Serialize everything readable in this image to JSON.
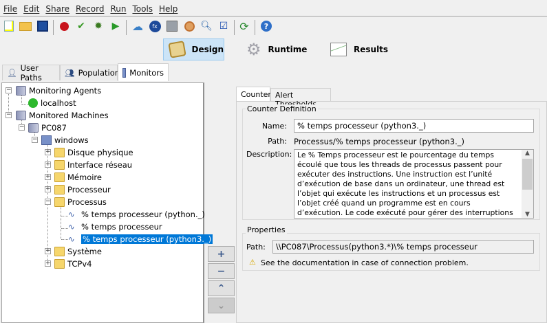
{
  "menu": [
    "File",
    "Edit",
    "Share",
    "Record",
    "Run",
    "Tools",
    "Help"
  ],
  "toolbar_icons": [
    "new-project-icon",
    "open-project-icon",
    "save-icon",
    "record-icon",
    "check-user-path-icon",
    "debug-icon",
    "run-icon",
    "cloud-icon",
    "variables-icon",
    "database-icon",
    "certificate-icon",
    "search-icon",
    "checklist-icon",
    "update-icon",
    "help-icon"
  ],
  "perspectives": {
    "design": "Design",
    "runtime": "Runtime",
    "results": "Results"
  },
  "tabs": {
    "user_paths": "User Paths",
    "populations": "Populations",
    "monitors": "Monitors"
  },
  "tree": {
    "monitoring_agents": "Monitoring Agents",
    "localhost": "localhost",
    "monitored_machines": "Monitored Machines",
    "pc": "PC087",
    "windows": "windows",
    "folders": [
      "Disque physique",
      "Interface réseau",
      "Mémoire",
      "Processeur",
      "Processus"
    ],
    "counters": [
      "% temps processeur (python._)",
      "% temps processeur",
      "% temps processeur (python3._)"
    ],
    "folders_after": [
      "Système",
      "TCPv4"
    ]
  },
  "right_tabs": {
    "counter": "Counter",
    "alert": "Alert Thresholds"
  },
  "counter_def": {
    "legend": "Counter Definition",
    "name_label": "Name:",
    "name_value": "% temps processeur (python3._)",
    "path_label": "Path:",
    "path_value": "Processus/% temps processeur (python3._)",
    "desc_label": "Description:",
    "description": "Le % Temps processeur est le pourcentage du temps écoulé que tous les threads de processus passent pour exécuter des instructions. Une instruction est l’unité d’exécution de base dans un ordinateur, une thread est l’objet qui exécute les instructions et un processus est l’objet créé quand un programme est en cours d’exécution. Le code exécuté pour gérer des interruptions dues au matériel et gérer des conditions de déroutement est inclus dans ce"
  },
  "properties": {
    "legend": "Properties",
    "path_label": "Path:",
    "path_value": "\\\\PC087\\Processus(python3.*)\\% temps processeur",
    "warning": "See the documentation in case of connection problem."
  },
  "side_buttons": {
    "add": "+",
    "remove": "−",
    "up": "⌃",
    "down": "⌄"
  }
}
